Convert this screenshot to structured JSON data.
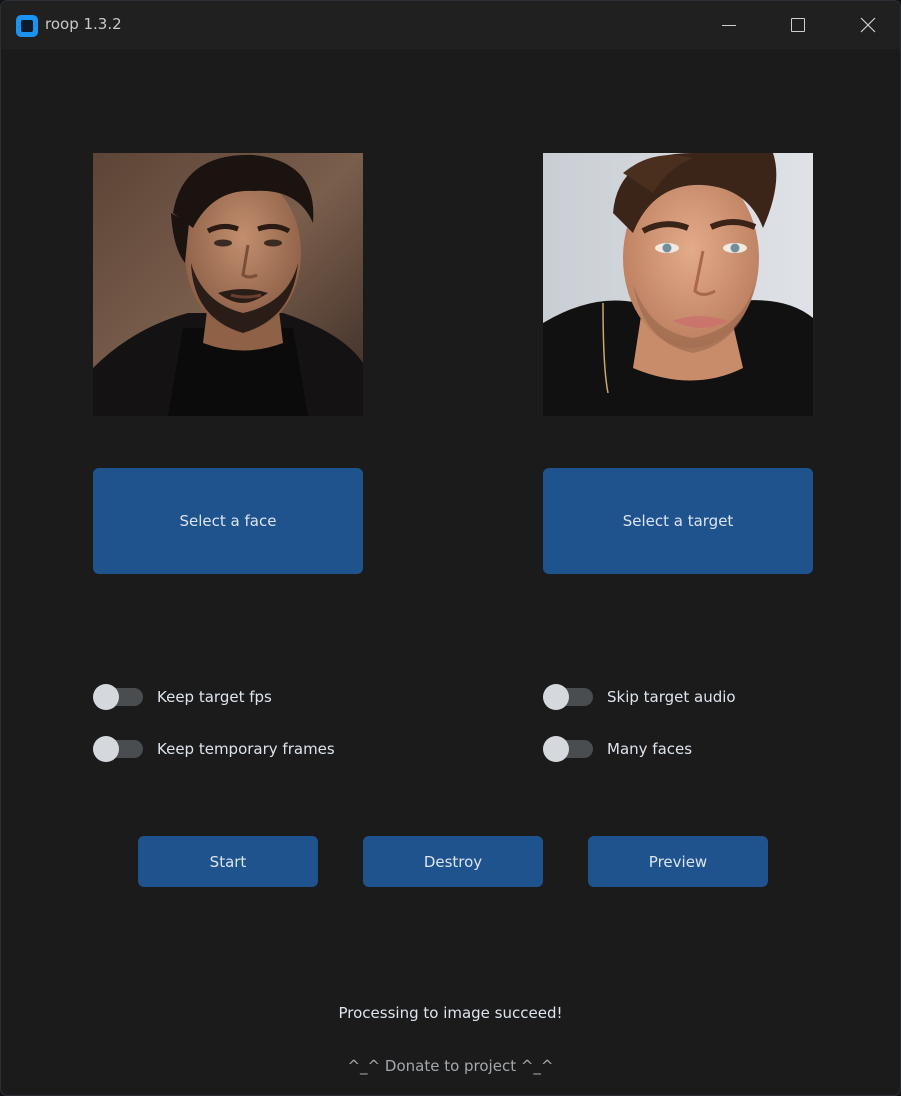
{
  "window": {
    "title": "roop 1.3.2",
    "icon": "roop-app-icon",
    "controls": [
      "minimize-icon",
      "maximize-icon",
      "close-icon"
    ]
  },
  "images": {
    "source": "source-face-photo",
    "target": "target-face-photo"
  },
  "buttons": {
    "select_face": "Select a face",
    "select_target": "Select a target",
    "start": "Start",
    "destroy": "Destroy",
    "preview": "Preview"
  },
  "switches": {
    "keep_fps": {
      "label": "Keep target fps",
      "on": false
    },
    "keep_frames": {
      "label": "Keep temporary frames",
      "on": false
    },
    "skip_audio": {
      "label": "Skip target audio",
      "on": false
    },
    "many_faces": {
      "label": "Many faces",
      "on": false
    }
  },
  "status": "Processing to image succeed!",
  "donate": "^_^ Donate to project ^_^",
  "colors": {
    "background": "#1b1b1b",
    "titlebar": "#202020",
    "button": "#1f538d",
    "button_text": "#dce4ee",
    "switch_track": "#4a4d50",
    "switch_knob": "#d5d9de",
    "accent": "#1a93f0"
  }
}
